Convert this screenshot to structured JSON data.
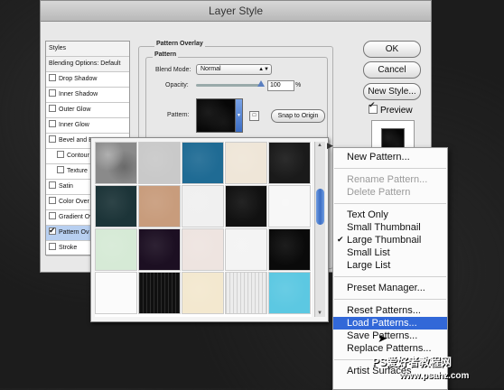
{
  "dialog": {
    "title": "Layer Style",
    "styles_header": "Styles",
    "blending_options": "Blending Options: Default",
    "effects": [
      {
        "label": "Drop Shadow",
        "checked": false,
        "indent": false,
        "selected": false
      },
      {
        "label": "Inner Shadow",
        "checked": false,
        "indent": false,
        "selected": false
      },
      {
        "label": "Outer Glow",
        "checked": false,
        "indent": false,
        "selected": false
      },
      {
        "label": "Inner Glow",
        "checked": false,
        "indent": false,
        "selected": false
      },
      {
        "label": "Bevel and E",
        "checked": false,
        "indent": false,
        "selected": false
      },
      {
        "label": "Contour",
        "checked": false,
        "indent": true,
        "selected": false
      },
      {
        "label": "Texture",
        "checked": false,
        "indent": true,
        "selected": false
      },
      {
        "label": "Satin",
        "checked": false,
        "indent": false,
        "selected": false
      },
      {
        "label": "Color Over",
        "checked": false,
        "indent": false,
        "selected": false
      },
      {
        "label": "Gradient Ov",
        "checked": false,
        "indent": false,
        "selected": false
      },
      {
        "label": "Pattern Ov",
        "checked": true,
        "indent": false,
        "selected": true
      },
      {
        "label": "Stroke",
        "checked": false,
        "indent": false,
        "selected": false
      }
    ],
    "panel": {
      "group_title": "Pattern Overlay",
      "sub_title": "Pattern",
      "blend_mode_label": "Blend Mode:",
      "blend_mode_value": "Normal",
      "opacity_label": "Opacity:",
      "opacity_value": "100",
      "opacity_unit": "%",
      "opacity_level": 1.0,
      "pattern_label": "Pattern:",
      "snap_button": "Snap to Origin"
    },
    "buttons": {
      "ok": "OK",
      "cancel": "Cancel",
      "new_style": "New Style...",
      "preview_label": "Preview",
      "preview_checked": true
    }
  },
  "picker": {
    "tiles": [
      {
        "color": "#8a8a8a",
        "kind": "noise"
      },
      {
        "color": "#c9c9c9",
        "kind": "plain"
      },
      {
        "color": "#1f6b94",
        "kind": "plain"
      },
      {
        "color": "#efe6d8",
        "kind": "plain"
      },
      {
        "color": "#1a1a1a",
        "kind": "plain"
      },
      {
        "color": "#1c3438",
        "kind": "plain"
      },
      {
        "color": "#c89c7c",
        "kind": "plain"
      },
      {
        "color": "#f0f0f0",
        "kind": "plain"
      },
      {
        "color": "#111111",
        "kind": "plain"
      },
      {
        "color": "#f7f7f7",
        "kind": "plain"
      },
      {
        "color": "#d6ead6",
        "kind": "plain"
      },
      {
        "color": "#1c0f22",
        "kind": "plain"
      },
      {
        "color": "#eee4e0",
        "kind": "plain"
      },
      {
        "color": "#f4f4f4",
        "kind": "plain"
      },
      {
        "color": "#0a0a0a",
        "kind": "plain"
      },
      {
        "color": "#fbfbfb",
        "kind": "plain"
      },
      {
        "color": "#101010",
        "kind": "stripes"
      },
      {
        "color": "#f3e8cf",
        "kind": "plain"
      },
      {
        "color": "#ececec",
        "kind": "stripes"
      },
      {
        "color": "#5cc8e2",
        "kind": "plain"
      }
    ]
  },
  "menu": {
    "items": [
      {
        "label": "New Pattern...",
        "disabled": false,
        "checked": false,
        "highlight": false,
        "sep_before": false
      },
      {
        "label": "Rename Pattern...",
        "disabled": true,
        "checked": false,
        "highlight": false,
        "sep_before": true
      },
      {
        "label": "Delete Pattern",
        "disabled": true,
        "checked": false,
        "highlight": false,
        "sep_before": false
      },
      {
        "label": "Text Only",
        "disabled": false,
        "checked": false,
        "highlight": false,
        "sep_before": true
      },
      {
        "label": "Small Thumbnail",
        "disabled": false,
        "checked": false,
        "highlight": false,
        "sep_before": false
      },
      {
        "label": "Large Thumbnail",
        "disabled": false,
        "checked": true,
        "highlight": false,
        "sep_before": false
      },
      {
        "label": "Small List",
        "disabled": false,
        "checked": false,
        "highlight": false,
        "sep_before": false
      },
      {
        "label": "Large List",
        "disabled": false,
        "checked": false,
        "highlight": false,
        "sep_before": false
      },
      {
        "label": "Preset Manager...",
        "disabled": false,
        "checked": false,
        "highlight": false,
        "sep_before": true
      },
      {
        "label": "Reset Patterns...",
        "disabled": false,
        "checked": false,
        "highlight": false,
        "sep_before": true
      },
      {
        "label": "Load Patterns...",
        "disabled": false,
        "checked": false,
        "highlight": true,
        "sep_before": false
      },
      {
        "label": "Save Patterns...",
        "disabled": false,
        "checked": false,
        "highlight": false,
        "sep_before": false
      },
      {
        "label": "Replace Patterns...",
        "disabled": false,
        "checked": false,
        "highlight": false,
        "sep_before": false
      },
      {
        "label": "Artist Surfaces",
        "disabled": false,
        "checked": false,
        "highlight": false,
        "sep_before": true
      }
    ],
    "check_glyph": "✔"
  },
  "watermark": {
    "line1": "PS爱好者教程网",
    "line2": "www.psahz.com"
  },
  "colors": {
    "highlight": "#3268d8",
    "scroll_thumb": "#3b6dc4"
  }
}
